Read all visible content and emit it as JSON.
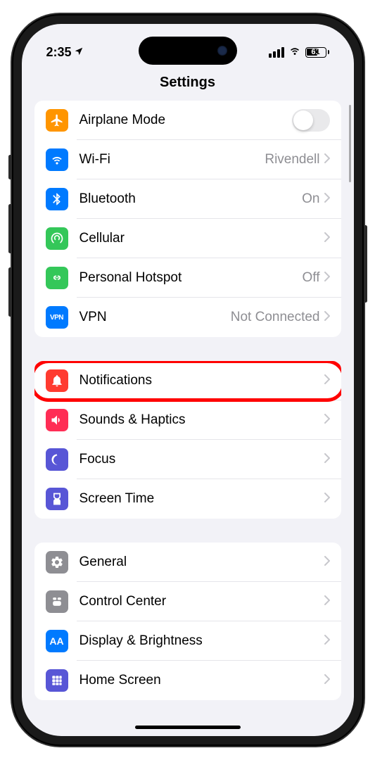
{
  "status": {
    "time": "2:35",
    "battery_pct": "61"
  },
  "header": {
    "title": "Settings"
  },
  "groups": [
    {
      "rows": [
        {
          "icon": "airplane",
          "label": "Airplane Mode",
          "toggle": false,
          "color": "bg-orange"
        },
        {
          "icon": "wifi",
          "label": "Wi-Fi",
          "value": "Rivendell",
          "chevron": true,
          "color": "bg-blue"
        },
        {
          "icon": "bluetooth",
          "label": "Bluetooth",
          "value": "On",
          "chevron": true,
          "color": "bg-blue"
        },
        {
          "icon": "cellular",
          "label": "Cellular",
          "chevron": true,
          "color": "bg-green"
        },
        {
          "icon": "hotspot",
          "label": "Personal Hotspot",
          "value": "Off",
          "chevron": true,
          "color": "bg-green"
        },
        {
          "icon": "vpn",
          "label": "VPN",
          "value": "Not Connected",
          "chevron": true,
          "color": "bg-blue"
        }
      ]
    },
    {
      "rows": [
        {
          "icon": "notifications",
          "label": "Notifications",
          "chevron": true,
          "color": "bg-red",
          "highlight": true
        },
        {
          "icon": "sounds",
          "label": "Sounds & Haptics",
          "chevron": true,
          "color": "bg-pink"
        },
        {
          "icon": "focus",
          "label": "Focus",
          "chevron": true,
          "color": "bg-indigo"
        },
        {
          "icon": "screentime",
          "label": "Screen Time",
          "chevron": true,
          "color": "bg-indigo"
        }
      ]
    },
    {
      "rows": [
        {
          "icon": "general",
          "label": "General",
          "chevron": true,
          "color": "bg-gray"
        },
        {
          "icon": "controlcenter",
          "label": "Control Center",
          "chevron": true,
          "color": "bg-gray"
        },
        {
          "icon": "display",
          "label": "Display & Brightness",
          "chevron": true,
          "color": "bg-bluedark"
        },
        {
          "icon": "homescreen",
          "label": "Home Screen",
          "chevron": true,
          "color": "bg-indigo"
        }
      ]
    }
  ]
}
